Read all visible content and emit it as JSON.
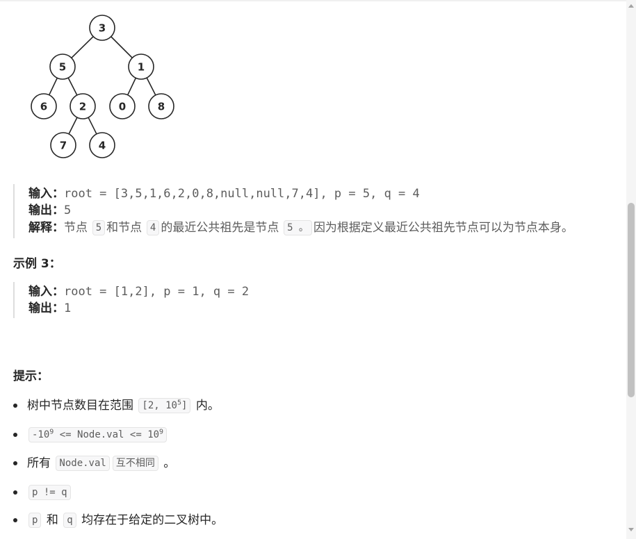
{
  "tree": {
    "nodes": [
      "3",
      "5",
      "1",
      "6",
      "2",
      "0",
      "8",
      "7",
      "4"
    ]
  },
  "example2": {
    "input_label": "输入：",
    "input_value": "root = [3,5,1,6,2,0,8,null,null,7,4], p = 5, q = 4",
    "output_label": "输出：",
    "output_value": "5",
    "explain_label": "解释：",
    "explain_part1": "节点",
    "explain_code1": "5",
    "explain_part2": "和节点",
    "explain_code2": "4",
    "explain_part3": "的最近公共祖先是节点",
    "explain_code3": "5 。",
    "explain_part4": "因为根据定义最近公共祖先节点可以为节点本身。"
  },
  "example3": {
    "title": "示例 3：",
    "input_label": "输入：",
    "input_value": "root = [1,2], p = 1, q = 2",
    "output_label": "输出：",
    "output_value": "1"
  },
  "hints": {
    "title": "提示：",
    "item1_text": "树中节点数目在范围",
    "item1_code_a": "[2, 10",
    "item1_code_sup": "5",
    "item1_code_b": "]",
    "item1_suffix": "内。",
    "item2_code_a": "-10",
    "item2_code_sup1": "9",
    "item2_code_b": " <= Node.val <= 10",
    "item2_code_sup2": "9",
    "item3_prefix": "所有",
    "item3_code1": "Node.val",
    "item3_code2": "互不相同",
    "item3_suffix": "。",
    "item4_code": "p != q",
    "item5_code1": "p",
    "item5_mid": "和",
    "item5_code2": "q",
    "item5_suffix": "均存在于给定的二叉树中。"
  }
}
